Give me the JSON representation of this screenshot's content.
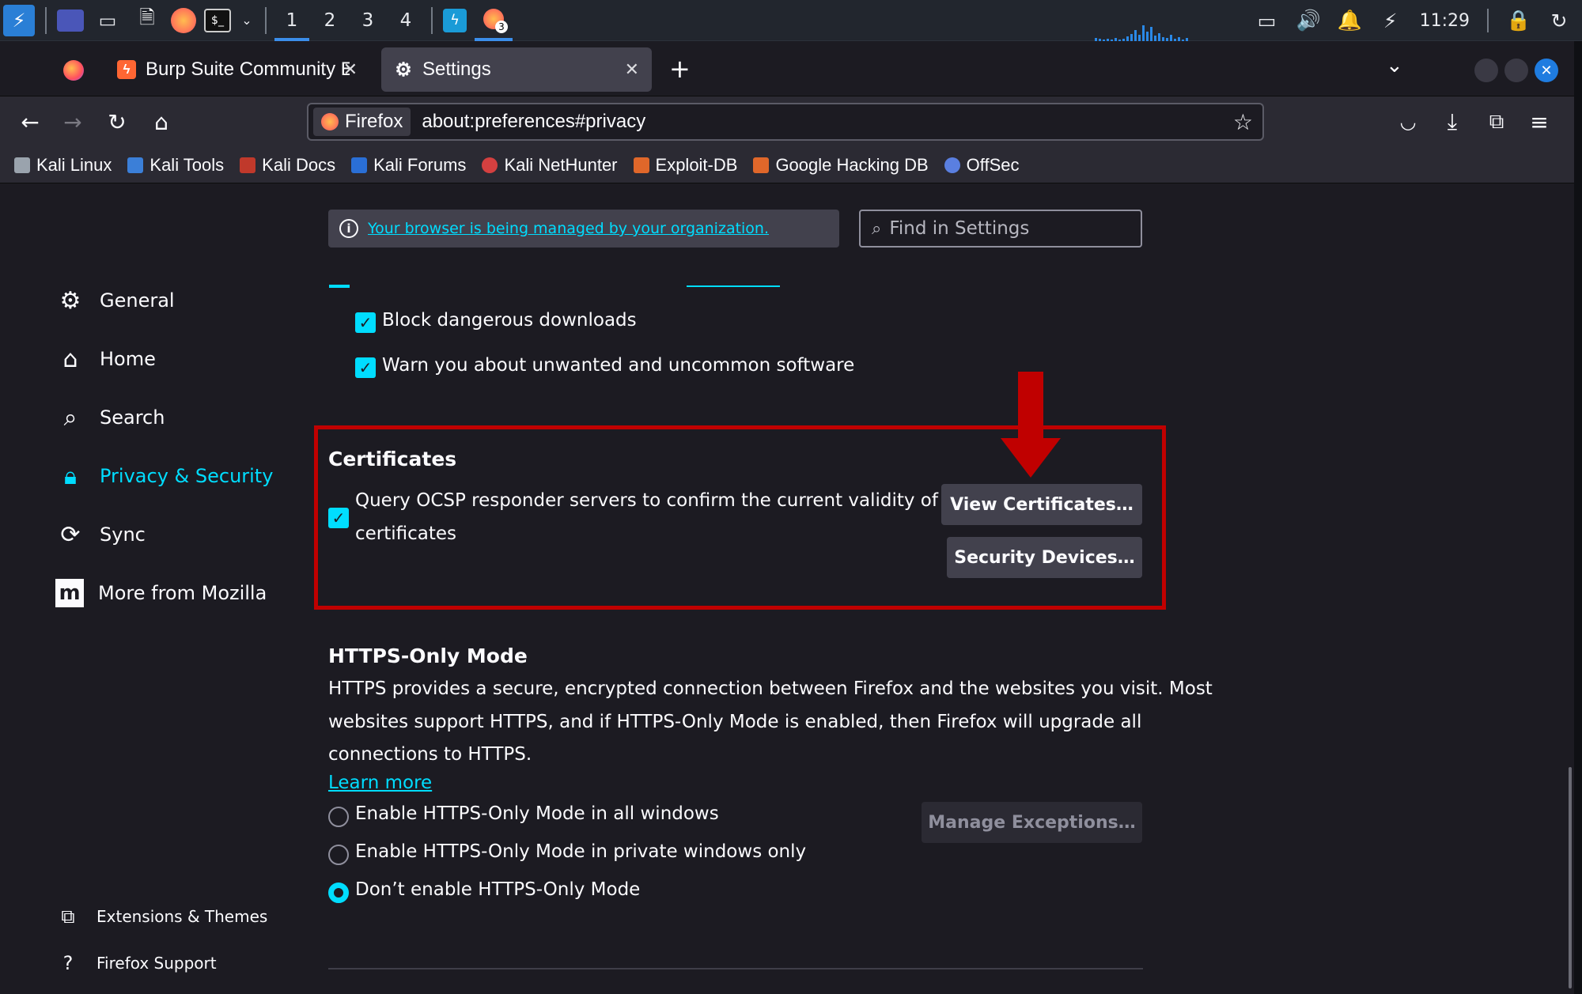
{
  "taskbar": {
    "workspaces": [
      "1",
      "2",
      "3",
      "4"
    ],
    "active_workspace": "1",
    "clock": "11:29",
    "notification_badge": "3"
  },
  "tabs": [
    {
      "title": "Burp Suite Community Ed",
      "icon": "burp-icon"
    },
    {
      "title": "Settings",
      "icon": "gear-icon",
      "active": true
    }
  ],
  "navbar": {
    "identity_label": "Firefox",
    "url": "about:preferences#privacy"
  },
  "bookmarks": [
    {
      "label": "Kali Linux",
      "color": "#9aa3ad"
    },
    {
      "label": "Kali Tools",
      "color": "#3b7fd8"
    },
    {
      "label": "Kali Docs",
      "color": "#c0392b"
    },
    {
      "label": "Kali Forums",
      "color": "#2a6fd6"
    },
    {
      "label": "Kali NetHunter",
      "color": "#d44040"
    },
    {
      "label": "Exploit-DB",
      "color": "#e0672a"
    },
    {
      "label": "Google Hacking DB",
      "color": "#e0672a"
    },
    {
      "label": "OffSec",
      "color": "#5a7fe0"
    }
  ],
  "banner": {
    "managed_text": "Your browser is being managed by your organization.",
    "find_placeholder": "Find in Settings"
  },
  "sidebar": {
    "items": [
      {
        "label": "General",
        "icon": "gear-icon"
      },
      {
        "label": "Home",
        "icon": "home-icon"
      },
      {
        "label": "Search",
        "icon": "search-icon"
      },
      {
        "label": "Privacy & Security",
        "icon": "lock-icon",
        "selected": true
      },
      {
        "label": "Sync",
        "icon": "sync-icon"
      },
      {
        "label": "More from Mozilla",
        "icon": "mozilla-icon"
      }
    ],
    "footer": [
      {
        "label": "Extensions & Themes",
        "icon": "puzzle-icon"
      },
      {
        "label": "Firefox Support",
        "icon": "help-icon"
      }
    ]
  },
  "security": {
    "block_downloads": "Block dangerous downloads",
    "warn_software": "Warn you about unwanted and uncommon software"
  },
  "certificates": {
    "heading": "Certificates",
    "ocsp_line1": "Query OCSP responder servers to confirm the current validity of",
    "ocsp_line2": "certificates",
    "view_button": "View Certificates…",
    "devices_button": "Security Devices…"
  },
  "https_only": {
    "heading": "HTTPS-Only Mode",
    "desc_line1": "HTTPS provides a secure, encrypted connection between Firefox and the websites you visit. Most",
    "desc_line2": "websites support HTTPS, and if HTTPS-Only Mode is enabled, then Firefox will upgrade all",
    "desc_line3": "connections to HTTPS.",
    "learn_more": "Learn more",
    "options": [
      "Enable HTTPS-Only Mode in all windows",
      "Enable HTTPS-Only Mode in private windows only",
      "Don’t enable HTTPS-Only Mode"
    ],
    "selected_option": 2,
    "manage_button": "Manage Exceptions…"
  },
  "colors": {
    "accent": "#00ddff",
    "highlight": "#c00000"
  }
}
